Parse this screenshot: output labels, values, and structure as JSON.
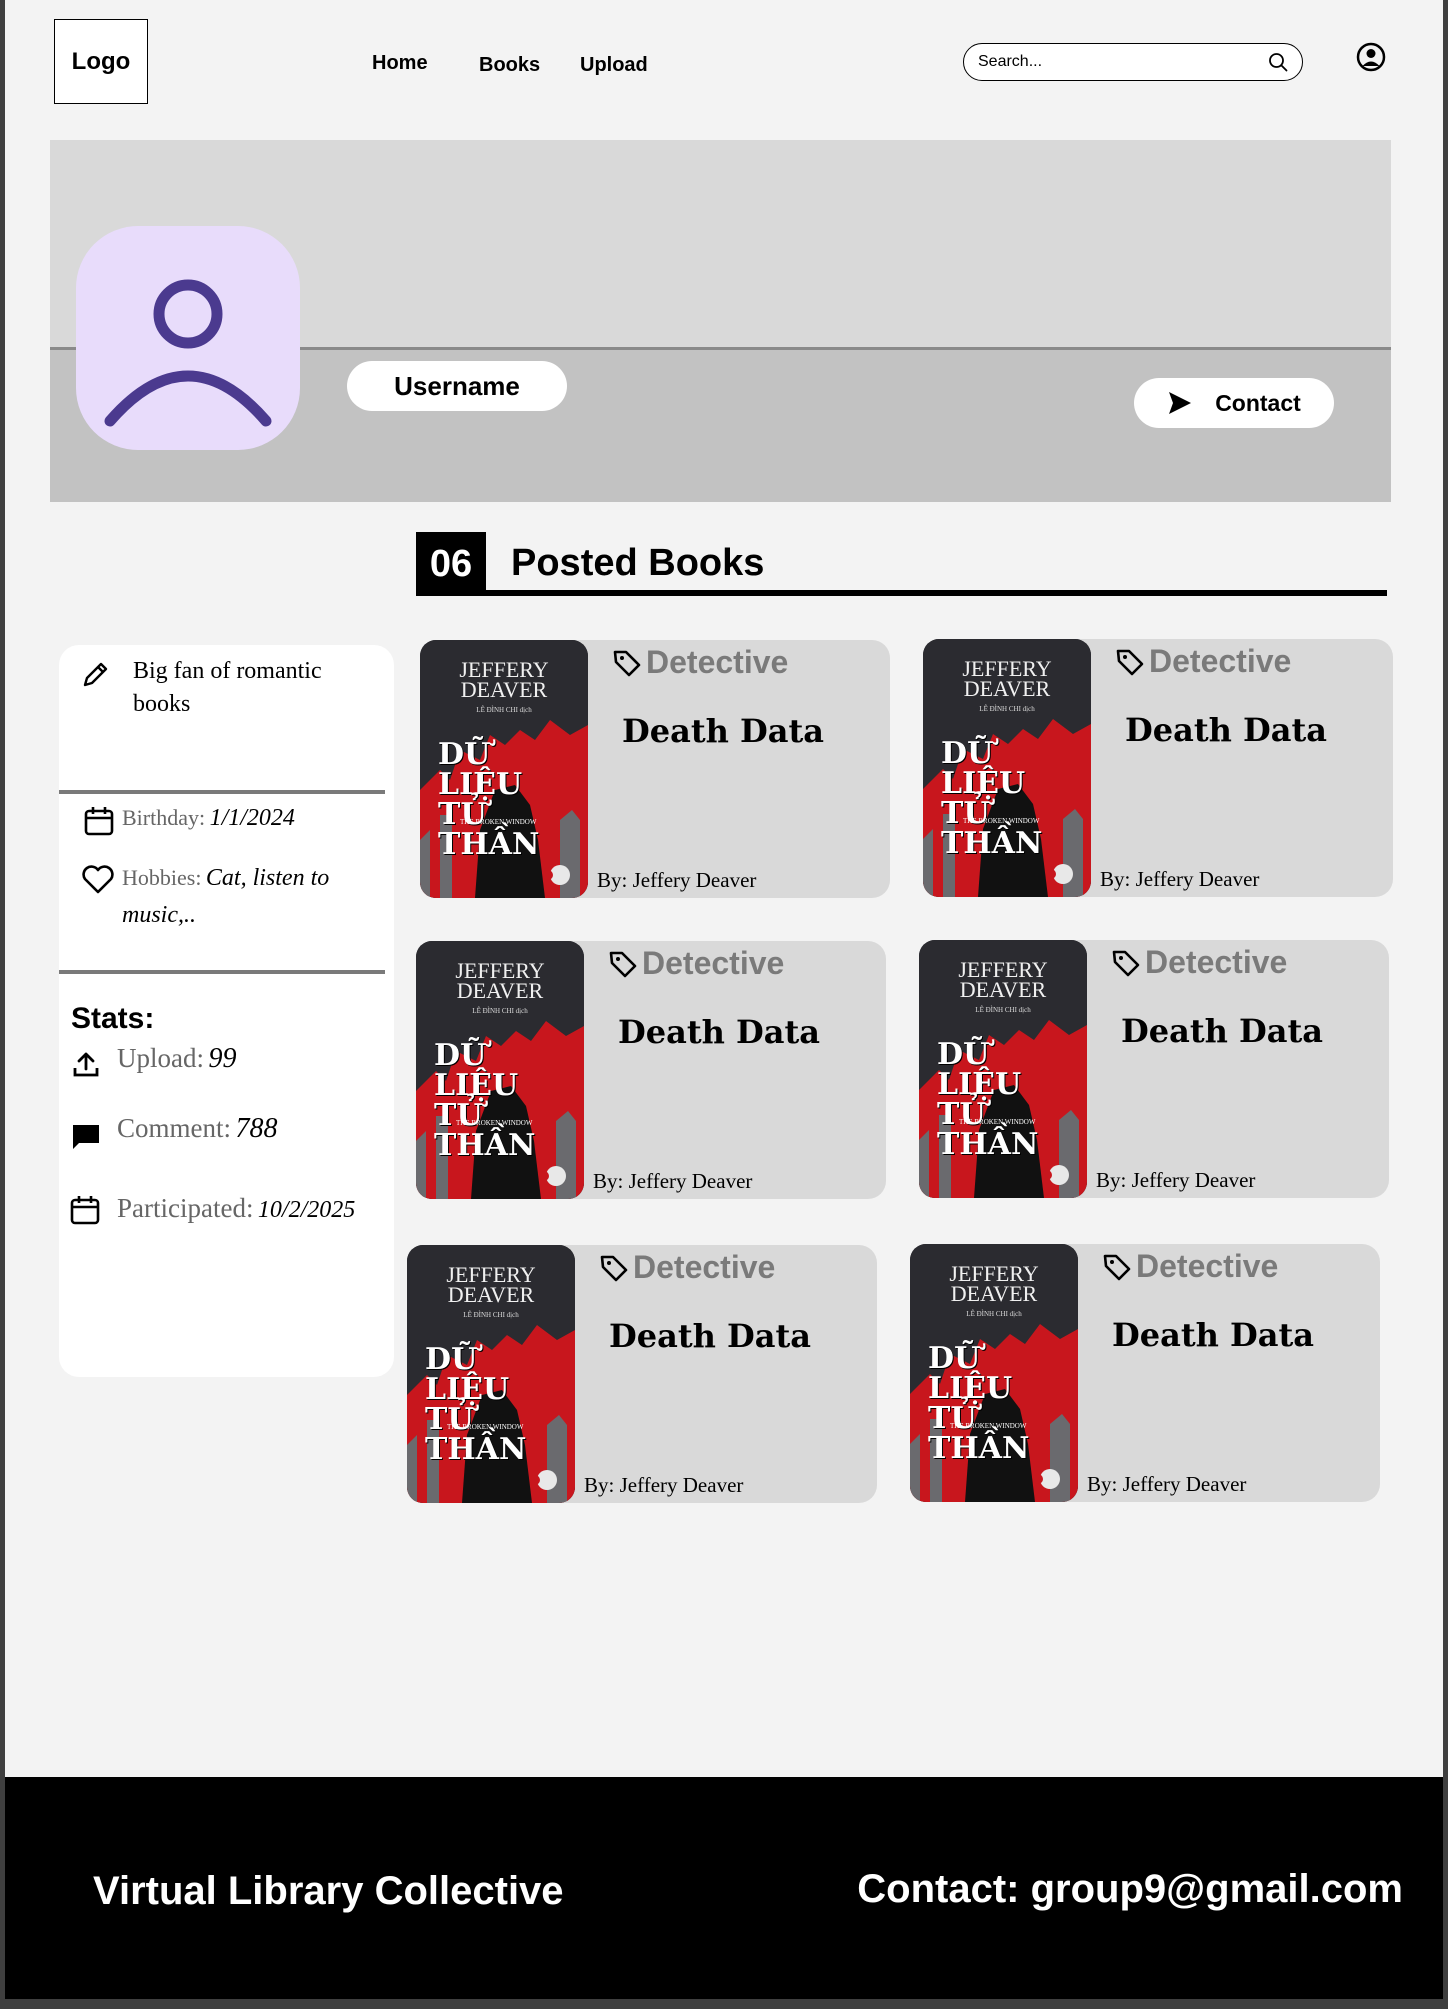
{
  "header": {
    "logo": "Logo",
    "nav": [
      "Home",
      "Books",
      "Upload"
    ],
    "search_placeholder": "Search..."
  },
  "profile": {
    "username": "Username",
    "contact_label": "Contact"
  },
  "posted": {
    "count": "06",
    "title": "Posted Books"
  },
  "info": {
    "bio": "Big fan of romantic books",
    "birthday_label": "Birthday:",
    "birthday_value": "1/1/2024",
    "hobbies_label": "Hobbies:",
    "hobbies_value": "Cat, listen to music,..",
    "stats_title": "Stats:",
    "upload_label": "Upload:",
    "upload_value": "99",
    "comment_label": "Comment:",
    "comment_value": "788",
    "participated_label": "Participated:",
    "participated_value": "10/2/2025"
  },
  "books": [
    {
      "genre": "Detective",
      "title": "Death Data",
      "author": "By: Jeffery Deaver",
      "cover_author": "JEFFERY DEAVER",
      "cover_title": "DỮ LIỆU TỬ THẦN",
      "cover_subtitle": "THE BROKEN WINDOW",
      "cover_translator": "LÊ ĐÌNH CHI dịch"
    },
    {
      "genre": "Detective",
      "title": "Death Data",
      "author": "By: Jeffery Deaver",
      "cover_author": "JEFFERY DEAVER",
      "cover_title": "DỮ LIỆU TỬ THẦN",
      "cover_subtitle": "THE BROKEN WINDOW",
      "cover_translator": "LÊ ĐÌNH CHI dịch"
    },
    {
      "genre": "Detective",
      "title": "Death Data",
      "author": "By: Jeffery Deaver",
      "cover_author": "JEFFERY DEAVER",
      "cover_title": "DỮ LIỆU TỬ THẦN",
      "cover_subtitle": "THE BROKEN WINDOW",
      "cover_translator": "LÊ ĐÌNH CHI dịch"
    },
    {
      "genre": "Detective",
      "title": "Death Data",
      "author": "By: Jeffery Deaver",
      "cover_author": "JEFFERY DEAVER",
      "cover_title": "DỮ LIỆU TỬ THẦN",
      "cover_subtitle": "THE BROKEN WINDOW",
      "cover_translator": "LÊ ĐÌNH CHI dịch"
    },
    {
      "genre": "Detective",
      "title": "Death Data",
      "author": "By: Jeffery Deaver",
      "cover_author": "JEFFERY DEAVER",
      "cover_title": "DỮ LIỆU TỬ THẦN",
      "cover_subtitle": "THE BROKEN WINDOW",
      "cover_translator": "LÊ ĐÌNH CHI dịch"
    },
    {
      "genre": "Detective",
      "title": "Death Data",
      "author": "By: Jeffery Deaver",
      "cover_author": "JEFFERY DEAVER",
      "cover_title": "DỮ LIỆU TỬ THẦN",
      "cover_subtitle": "THE BROKEN WINDOW",
      "cover_translator": "LÊ ĐÌNH CHI dịch"
    }
  ],
  "footer": {
    "name": "Virtual Library Collective",
    "contact": "Contact: group9@gmail.com"
  },
  "colors": {
    "avatar_bg": "#e8dcfb",
    "avatar_icon": "#4b3a8f",
    "banner": "#c2c2c2",
    "card": "#d9d9d9",
    "cover_red": "#c8161d"
  }
}
